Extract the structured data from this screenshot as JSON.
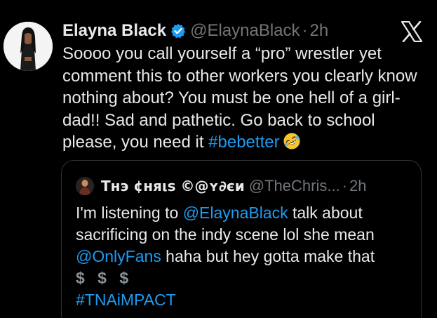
{
  "tweet": {
    "author_name": "Elayna Black",
    "handle": "@ElaynaBlack",
    "separator": "·",
    "time": "2h",
    "text_before": "Soooo you call yourself a “pro” wrestler yet comment this to other workers you clearly know nothing about? You must be one hell of a girl-dad!! Sad and pathetic. Go back to school please, you need it ",
    "hashtag": "#bebetter",
    "emoji": "rolling-on-floor-laughing-emoji"
  },
  "quote": {
    "author_name": "Tнэ ¢няιѕ ©@ʏ∂єи",
    "handle": "@TheChris...",
    "separator": "·",
    "time": "2h",
    "text_1": "I'm listening to ",
    "mention_1": "@ElaynaBlack",
    "text_2": " talk about sacrificing on the indy scene lol she mean ",
    "mention_2": "@OnlyFans",
    "text_3": " haha but hey gotta make that",
    "dollars": "$ $ $",
    "hashtag": "#TNAiMPACT"
  },
  "colors": {
    "background": "#000000",
    "text": "#e7e9ea",
    "secondary": "#71767b",
    "link": "#1d9bf0",
    "verified": "#1d9bf0",
    "border": "#2f3336"
  },
  "icons": {
    "verified": "verified-badge-icon",
    "platform": "x-logo-icon"
  }
}
